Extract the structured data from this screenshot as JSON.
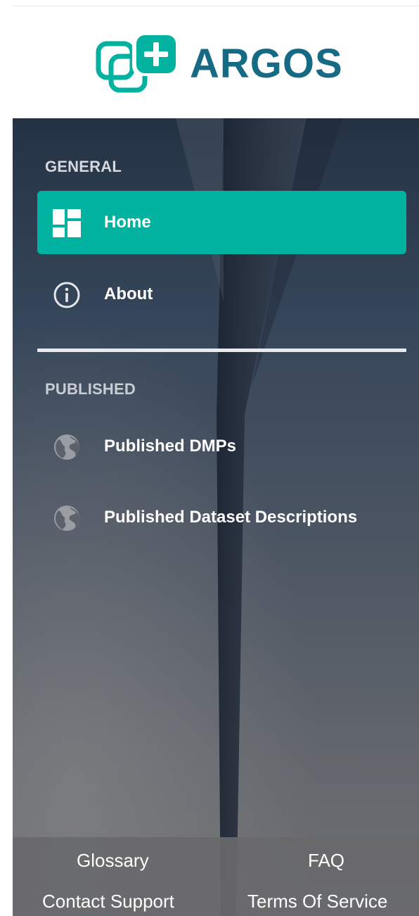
{
  "brand": {
    "name": "ARGOS",
    "logo_icon": "argos-logo-icon",
    "colors": {
      "primary": "#176a84",
      "accent": "#00b29f"
    }
  },
  "sidebar": {
    "sections": [
      {
        "header": "GENERAL"
      },
      {
        "header": "PUBLISHED"
      }
    ],
    "items": [
      {
        "label": "Home",
        "icon": "dashboard-icon",
        "active": true
      },
      {
        "label": "About",
        "icon": "info-icon",
        "active": false
      },
      {
        "label": "Published DMPs",
        "icon": "globe-icon",
        "active": false
      },
      {
        "label": "Published Dataset Descriptions",
        "icon": "globe-icon",
        "active": false
      }
    ]
  },
  "footer": {
    "links": [
      "Glossary",
      "FAQ",
      "Contact Support",
      "Terms Of Service"
    ]
  }
}
